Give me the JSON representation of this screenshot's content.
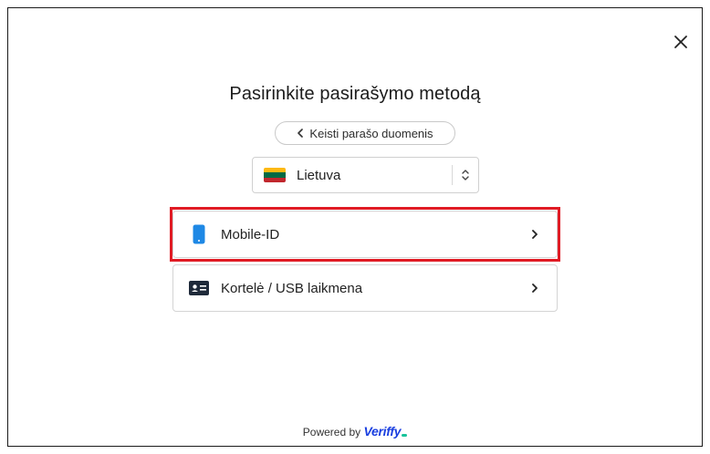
{
  "dialog": {
    "title": "Pasirinkite pasirašymo metodą",
    "back_button": {
      "label": "Keisti parašo duomenis",
      "icon": "chevron-left-icon"
    },
    "close_icon": "close-icon"
  },
  "country_select": {
    "selected": "Lietuva",
    "flag_colors": [
      "#fdb913",
      "#006a44",
      "#c1272d"
    ],
    "icon": "select-arrows-icon"
  },
  "methods": [
    {
      "label": "Mobile-ID",
      "icon": "mobile-phone-icon",
      "highlighted": true
    },
    {
      "label": "Kortelė / USB laikmena",
      "icon": "id-card-icon",
      "highlighted": false
    }
  ],
  "footer": {
    "powered_by": "Powered by",
    "brand": "Veriffy"
  },
  "colors": {
    "highlight": "#e01b24",
    "brand_blue": "#1a3fe0",
    "mobile_icon": "#1e88e5",
    "card_icon": "#1f2a3a"
  }
}
